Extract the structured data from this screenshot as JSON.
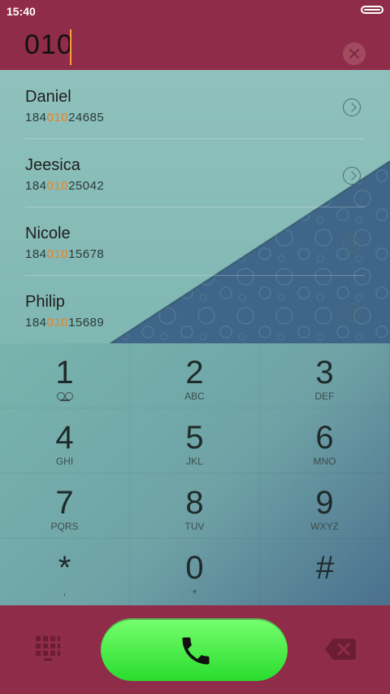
{
  "status_bar": {
    "time": "15:40"
  },
  "header": {
    "dialed": "010"
  },
  "contacts": [
    {
      "name": "Daniel",
      "number_pre": "184",
      "number_hl": "010",
      "number_post": "24685"
    },
    {
      "name": "Jeesica",
      "number_pre": "184",
      "number_hl": "010",
      "number_post": "25042"
    },
    {
      "name": "Nicole",
      "number_pre": "184",
      "number_hl": "010",
      "number_post": "15678"
    },
    {
      "name": "Philip",
      "number_pre": "184",
      "number_hl": "010",
      "number_post": "15689"
    }
  ],
  "keys": [
    {
      "digit": "1",
      "letters": ""
    },
    {
      "digit": "2",
      "letters": "ABC"
    },
    {
      "digit": "3",
      "letters": "DEF"
    },
    {
      "digit": "4",
      "letters": "GHI"
    },
    {
      "digit": "5",
      "letters": "JKL"
    },
    {
      "digit": "6",
      "letters": "MNO"
    },
    {
      "digit": "7",
      "letters": "PQRS"
    },
    {
      "digit": "8",
      "letters": "TUV"
    },
    {
      "digit": "9",
      "letters": "WXYZ"
    },
    {
      "digit": "*",
      "letters": ","
    },
    {
      "digit": "0",
      "letters": "+"
    },
    {
      "digit": "#",
      "letters": ""
    }
  ],
  "icons": {
    "clear": "close-circle-icon",
    "arrow": "chevron-right-circle-icon",
    "voicemail": "voicemail-icon",
    "keypad": "keypad-grid-icon",
    "call": "phone-icon",
    "delete": "backspace-icon"
  },
  "colors": {
    "header": "#8f2c49",
    "highlight": "#f08020",
    "call_green": "#2adc2e"
  }
}
